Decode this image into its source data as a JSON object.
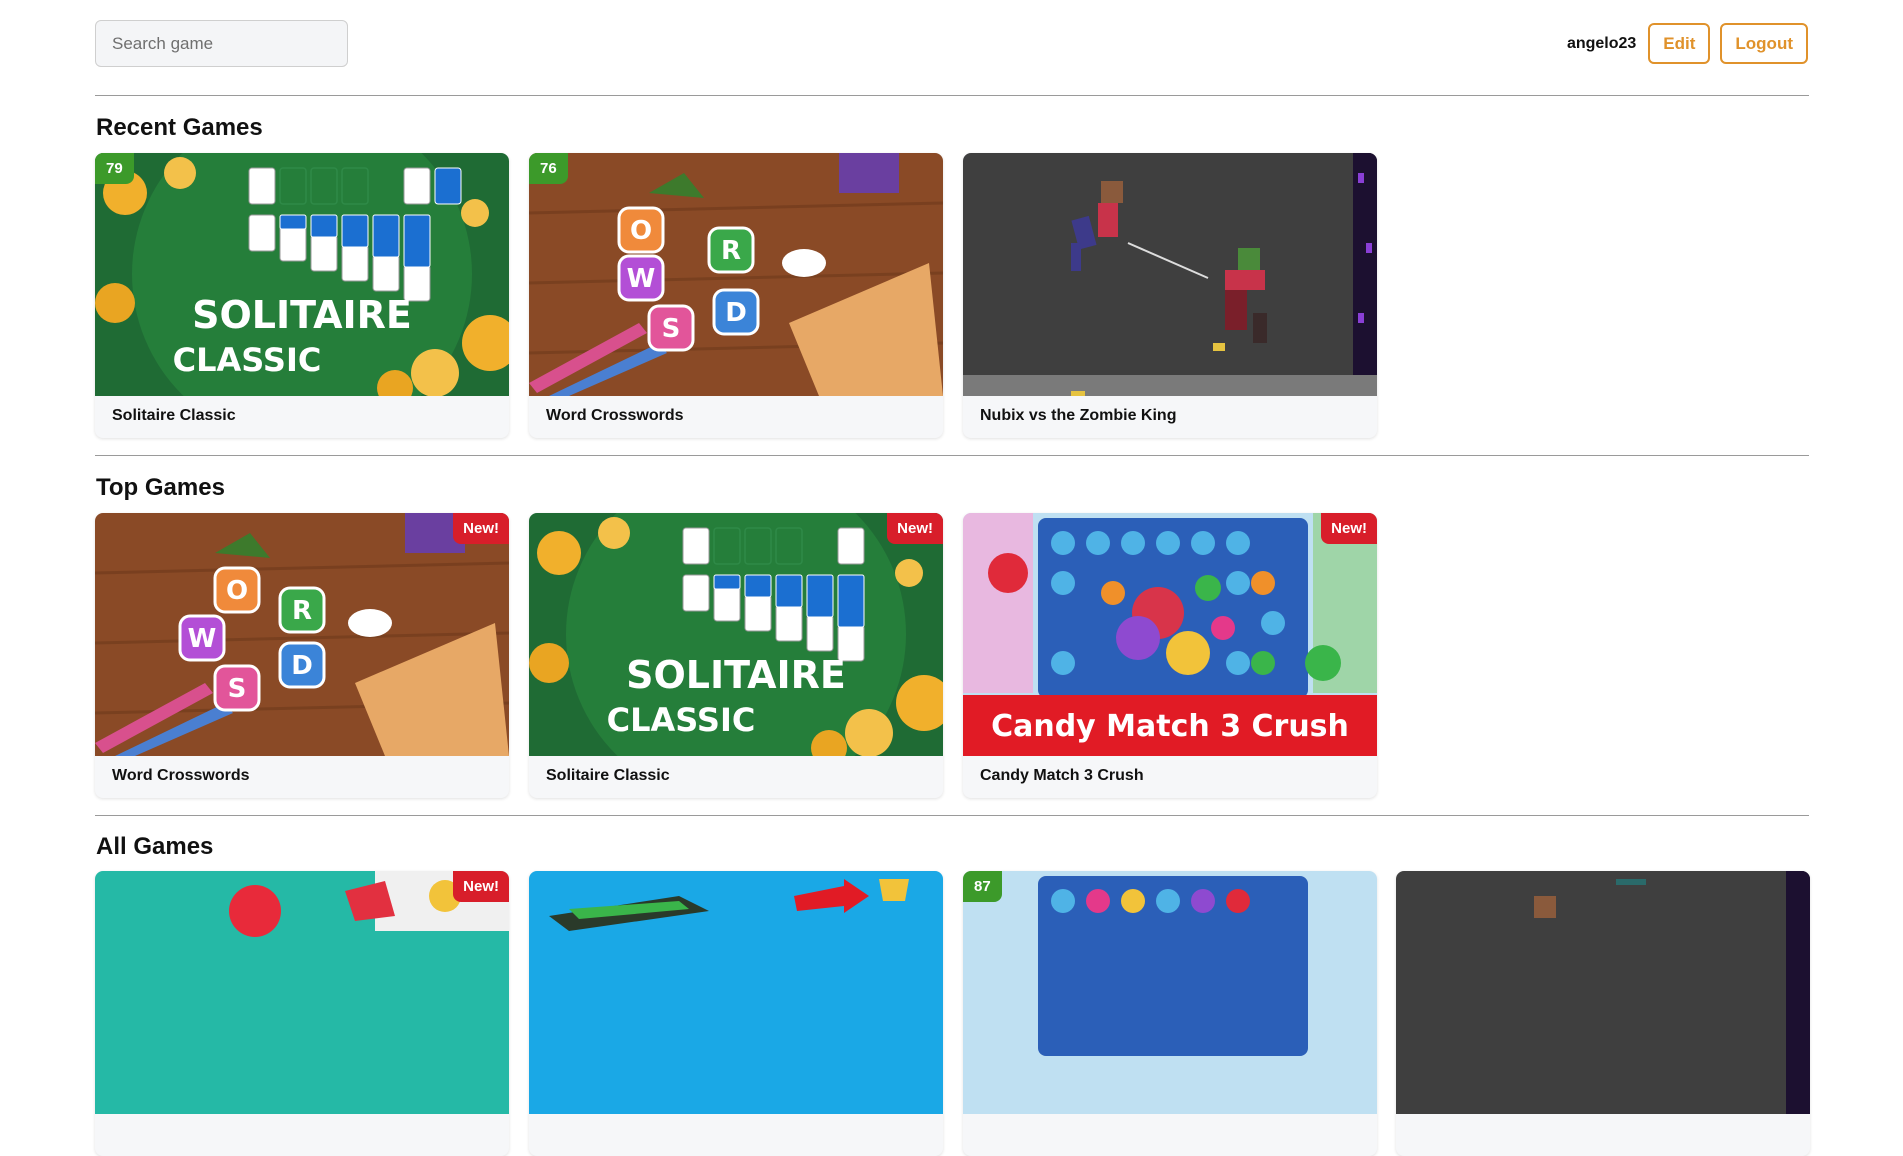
{
  "search": {
    "placeholder": "Search game",
    "value": ""
  },
  "user": {
    "name": "angelo23",
    "edit_label": "Edit",
    "logout_label": "Logout"
  },
  "colors": {
    "accent": "#e0922b",
    "score_badge": "#3c9a2a",
    "new_badge": "#d81e2a"
  },
  "sections": {
    "recent": {
      "title": "Recent Games",
      "games": [
        {
          "title": "Solitaire Classic",
          "score": "79",
          "art_text_1": "SOLITAIRE",
          "art_text_2": "CLASSIC"
        },
        {
          "title": "Word Crosswords",
          "score": "76",
          "art_letters": [
            "O",
            "W",
            "R",
            "S",
            "D"
          ]
        },
        {
          "title": "Nubix vs the Zombie King"
        }
      ]
    },
    "top": {
      "title": "Top Games",
      "games": [
        {
          "title": "Word Crosswords",
          "badge": "New!",
          "art_letters": [
            "O",
            "W",
            "R",
            "S",
            "D"
          ]
        },
        {
          "title": "Solitaire Classic",
          "badge": "New!",
          "art_text_1": "SOLITAIRE",
          "art_text_2": "CLASSIC"
        },
        {
          "title": "Candy Match 3 Crush",
          "badge": "New!",
          "art_banner": "Candy Match 3 Crush"
        }
      ]
    },
    "all": {
      "title": "All Games",
      "games": [
        {
          "badge": "New!"
        },
        {},
        {
          "score": "87"
        },
        {}
      ]
    }
  }
}
